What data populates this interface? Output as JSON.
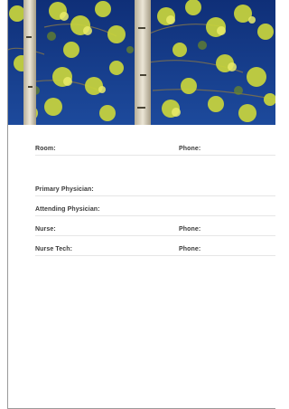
{
  "header_image": {
    "icon": "aspen-trees-photo",
    "sky_color": "#163a8a",
    "foliage_color": "#c8d43a",
    "trunk_color": "#d9d2bf"
  },
  "form": {
    "room_label": "Room:",
    "room_phone_label": "Phone:",
    "primary_physician_label": "Primary Physician:",
    "attending_physician_label": "Attending Physician:",
    "nurse_label": "Nurse:",
    "nurse_phone_label": "Phone:",
    "nurse_tech_label": "Nurse Tech:",
    "nurse_tech_phone_label": "Phone:"
  }
}
